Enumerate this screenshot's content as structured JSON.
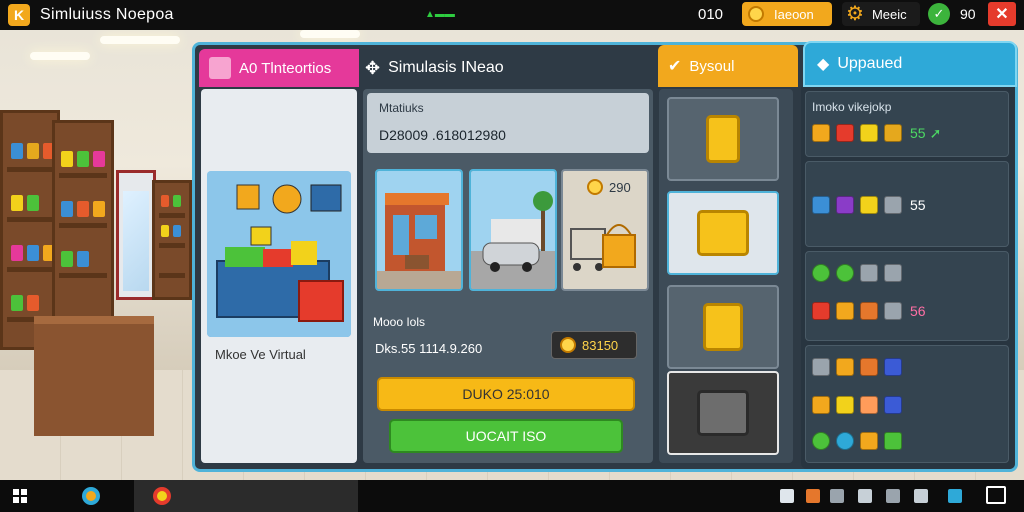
{
  "topbar": {
    "app_logo": "K",
    "title": "Simluiuss Noepoa",
    "counter": "010",
    "coin_label": "Iaeoon",
    "gear_label": "Meeic",
    "gem_label": "90",
    "close_symbol": "✕"
  },
  "tabs": {
    "left": "A0 Tlnteortios",
    "header": "Simulasis INeao",
    "mid": "Bysoul",
    "right": "Uppaued"
  },
  "preview": {
    "caption": "Mkoe Ve Virtual"
  },
  "info": {
    "label": "Mtatiuks",
    "value": "D28009 .618012980"
  },
  "thumbs": {
    "cart_price": "290"
  },
  "details": {
    "label": "Mooo Iols",
    "value": "Dks.55 1114.9.260",
    "price": "83150",
    "buy_label": "DUKO 25:010",
    "upgrade_label": "UOCAIT ISO"
  },
  "right_panel": {
    "title": "Imoko vikejokp",
    "row1_value": "55",
    "row2_value": "55",
    "row4_value": "56"
  },
  "colors": {
    "accent_orange": "#f2a81d",
    "accent_pink": "#e5399a",
    "accent_blue": "#2ea9d8",
    "accent_green": "#4cc23a",
    "close_red": "#e53b2c"
  },
  "icons": {
    "header": "puzzle-icon",
    "mid_tab": "check-tag-icon",
    "right_tab": "tag-icon",
    "coin": "coin-icon",
    "gear": "gear-icon",
    "gem": "gem-icon",
    "start": "start-icon"
  }
}
